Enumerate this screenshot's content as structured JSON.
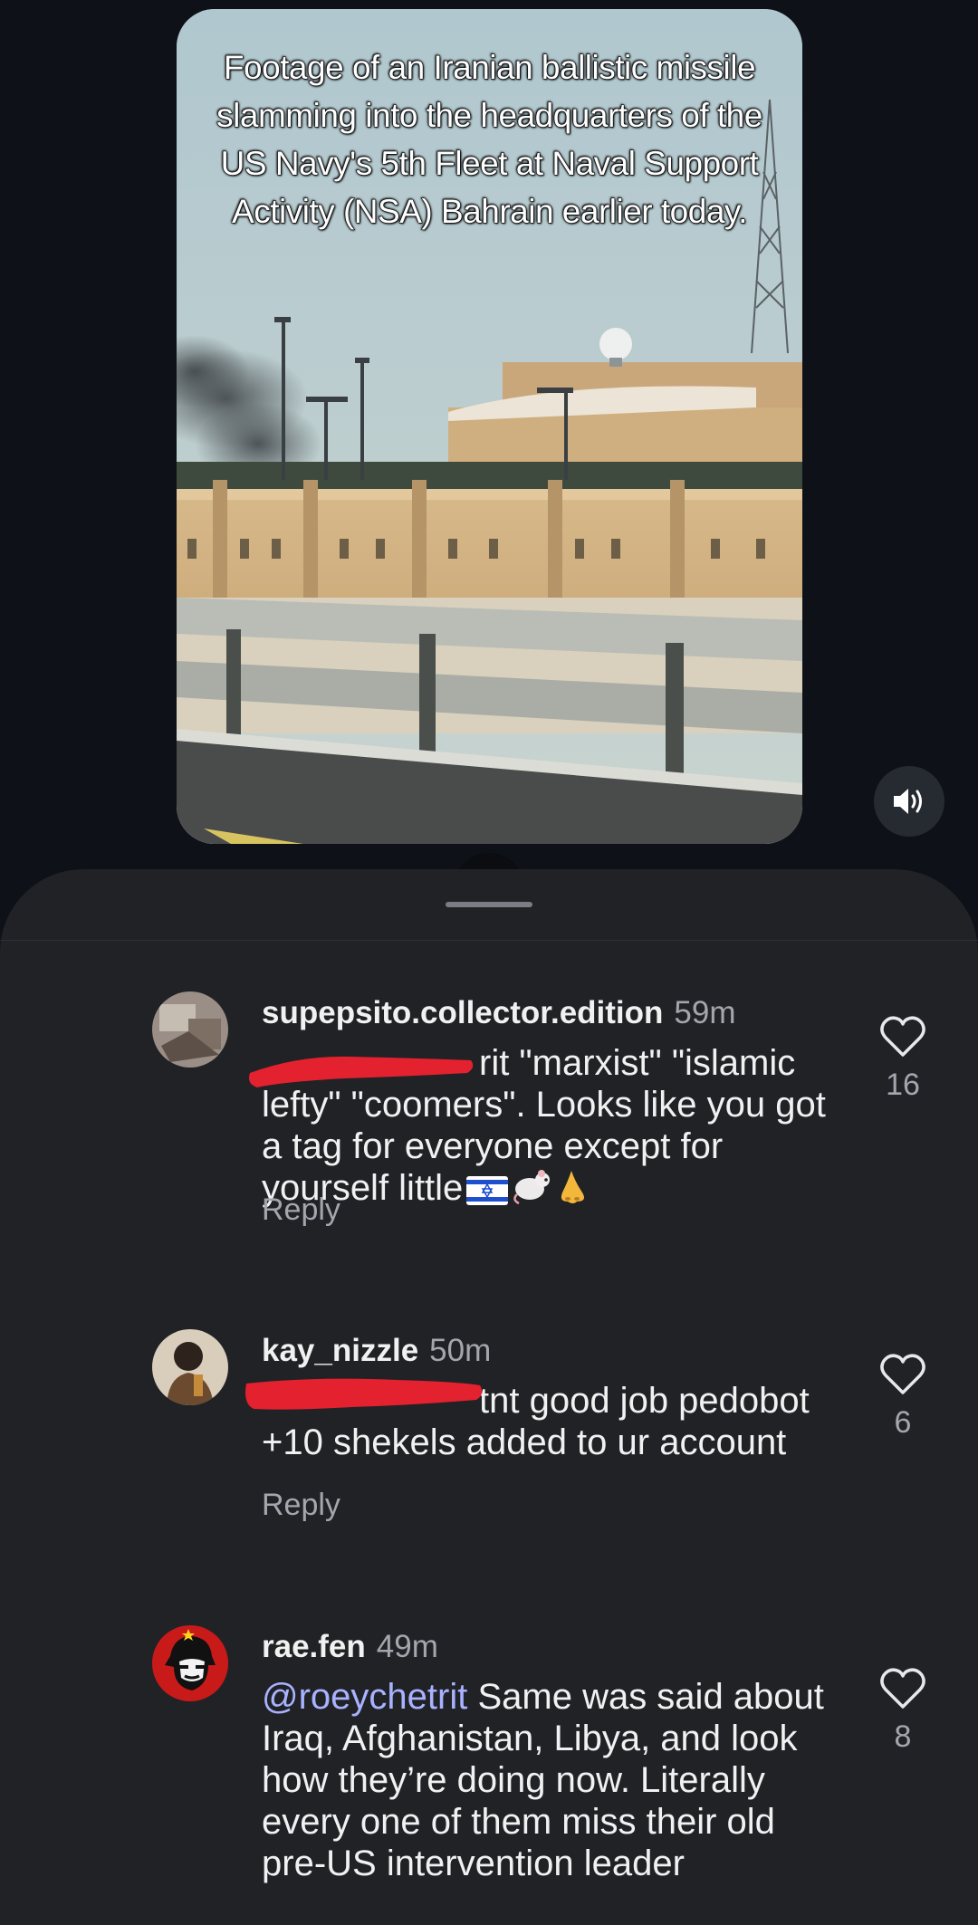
{
  "video": {
    "caption": "Footage of an Iranian ballistic missile slamming into the headquarters of the US Navy's 5th Fleet at Naval Support Activity (NSA) Bahrain earlier today.",
    "mute_icon": "speaker-volume-icon"
  },
  "comments": [
    {
      "username": "supepsito.collector.edition",
      "time": "59m",
      "text": "rit \"marxist\" \"islamic lefty\" \"coomers\". Looks like you got a tag for everyone except for yourself little",
      "emojis": [
        "israel-flag-emoji",
        "rat-emoji",
        "nose-emoji"
      ],
      "likes": "16",
      "reply_label": "Reply"
    },
    {
      "username": "kay_nizzle",
      "time": "50m",
      "text": "tnt good job pedobot +10 shekels added to ur account",
      "likes": "6",
      "reply_label": "Reply"
    },
    {
      "username": "rae.fen",
      "time": "49m",
      "mention": "@roeychetrit",
      "text": " Same was said about Iraq, Afghanistan, Libya, and look how they’re doing now. Literally every one of them miss their old pre-US intervention leader",
      "likes": "8"
    }
  ],
  "colors": {
    "background": "#0e1218",
    "sheet": "#212226",
    "mention": "#a8b2ff",
    "redaction": "#e3212f"
  }
}
